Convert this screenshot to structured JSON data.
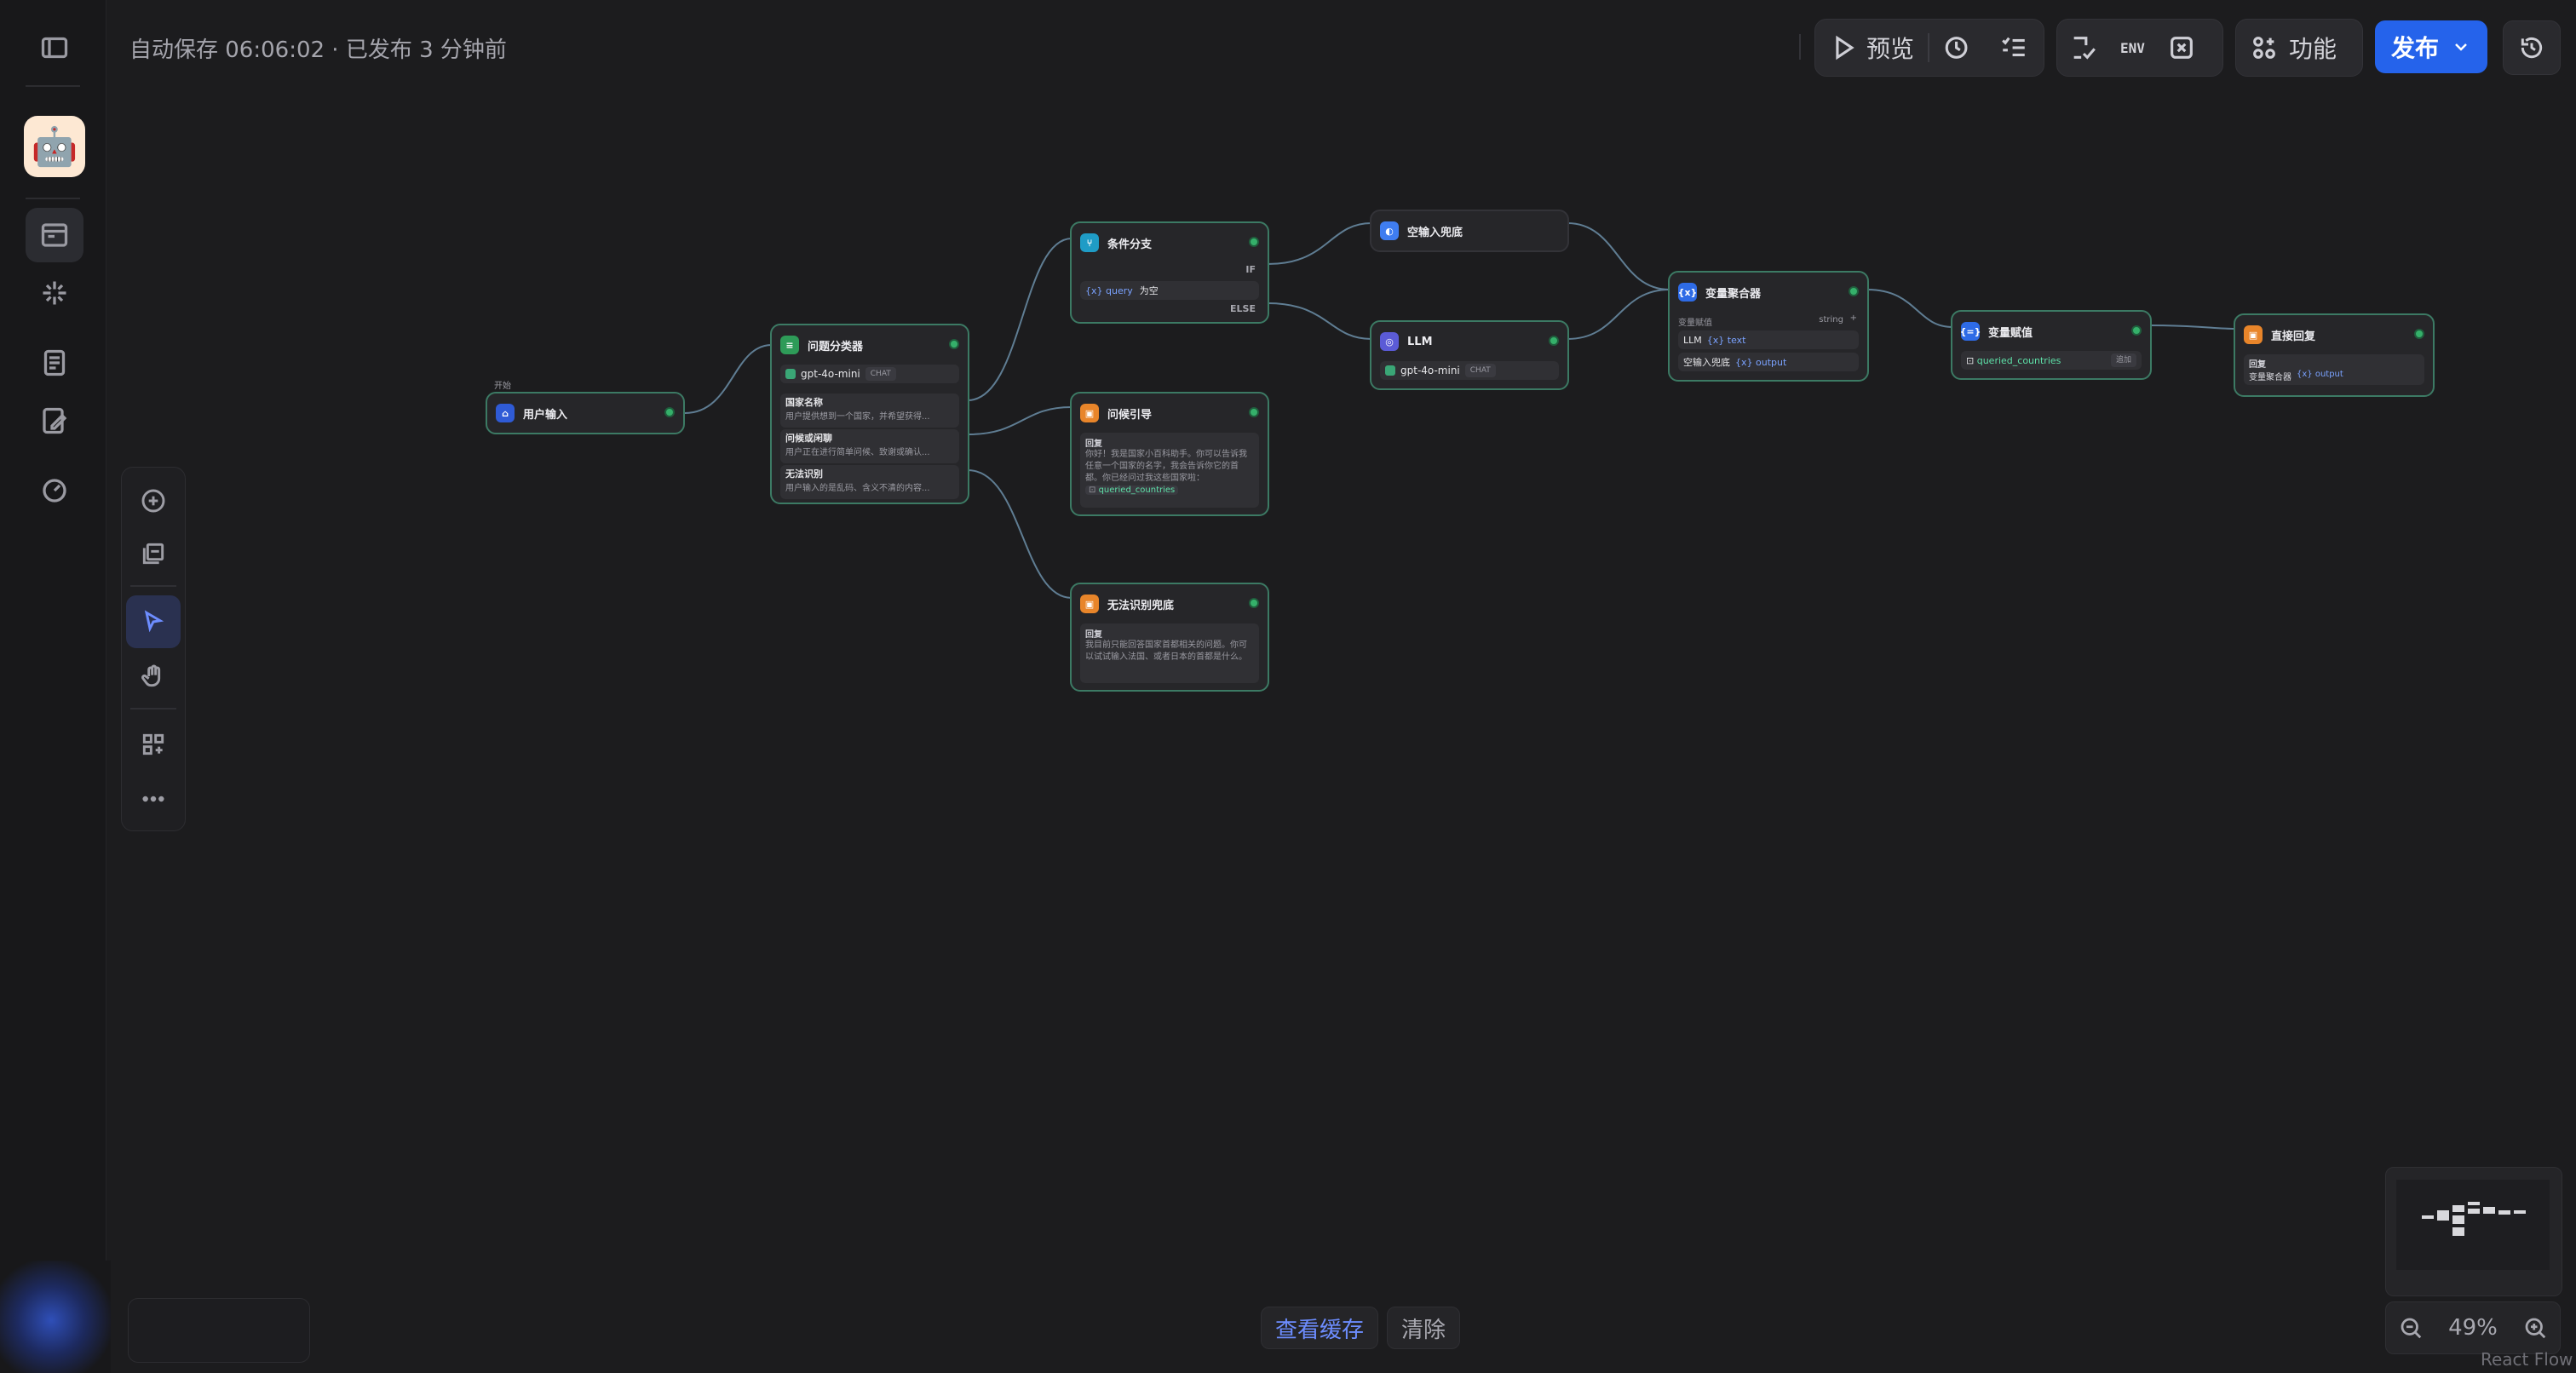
{
  "header": {
    "autosave": "自动保存 06:06:02 · 已发布 3 分钟前",
    "preview_label": "预览",
    "features_label": "功能",
    "publish_label": "发布",
    "env_label": "ENV"
  },
  "nodes": {
    "start": {
      "tag": "开始",
      "title": "用户输入"
    },
    "classifier": {
      "title": "问题分类器",
      "model": "gpt-4o-mini",
      "model_tag": "CHAT",
      "classes": [
        {
          "name": "国家名称",
          "desc": "用户提供想到一个国家，并希望获得..."
        },
        {
          "name": "问候或闲聊",
          "desc": "用户正在进行简单问候、致谢或确认..."
        },
        {
          "name": "无法识别",
          "desc": "用户输入的是乱码、含义不清的内容..."
        }
      ]
    },
    "ifelse": {
      "title": "条件分支",
      "if_label": "IF",
      "var": "{x} query",
      "cond": "为空",
      "else_label": "ELSE"
    },
    "greet": {
      "title": "问候引导",
      "section": "回复",
      "text": "你好！我是国家小百科助手。你可以告诉我任意一个国家的名字，我会告诉你它的首都。你已经问过我这些国家啦：",
      "var": "queried_countries"
    },
    "unknown": {
      "title": "无法识别兜底",
      "section": "回复",
      "text": "我目前只能回答国家首都相关的问题。你可以试试输入法国、或者日本的首都是什么。"
    },
    "empty": {
      "title": "空输入兜底"
    },
    "llm": {
      "title": "LLM",
      "model": "gpt-4o-mini",
      "model_tag": "CHAT"
    },
    "aggregator": {
      "title": "变量聚合器",
      "sub_label": "变量赋值",
      "type": "string",
      "rows": [
        {
          "src": "LLM",
          "var": "{x} text"
        },
        {
          "src": "空输入兜底",
          "var": "{x} output"
        }
      ]
    },
    "assigner": {
      "title": "变量赋值",
      "var": "queried_countries",
      "op": "追加"
    },
    "answer": {
      "title": "直接回复",
      "section": "回复",
      "src": "变量聚合器",
      "var": "{x} output"
    }
  },
  "bottom": {
    "view_cache": "查看缓存",
    "clear": "清除"
  },
  "zoom": {
    "level": "49%"
  },
  "attribution": "React Flow",
  "colors": {
    "accent": "#2563eb",
    "node_border": "#3c7a64",
    "ok": "#35b06a",
    "var": "#7aa2ff"
  }
}
